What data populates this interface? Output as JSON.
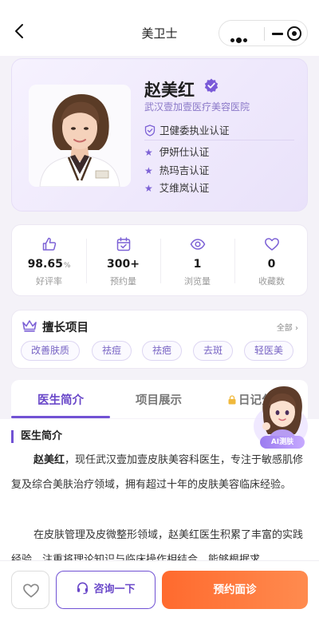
{
  "nav": {
    "title": "美卫士"
  },
  "doctor": {
    "name": "赵美红",
    "hospital": "武汉壹加壹医疗美容医院",
    "certification": "卫健委执业认证",
    "brand_certs": [
      "伊妍仕认证",
      "热玛吉认证",
      "艾维岚认证"
    ]
  },
  "stats": [
    {
      "icon": "thumbs-up-icon",
      "value": "98.65",
      "unit": "%",
      "label": "好评率"
    },
    {
      "icon": "calendar-check-icon",
      "value": "300+",
      "unit": "",
      "label": "预约量"
    },
    {
      "icon": "eye-icon",
      "value": "1",
      "unit": "",
      "label": "浏览量"
    },
    {
      "icon": "heart-icon",
      "value": "0",
      "unit": "",
      "label": "收藏数"
    }
  ],
  "specialties": {
    "title": "擅长项目",
    "view_all": "全部 ›",
    "items": [
      "改善肤质",
      "祛痘",
      "祛疤",
      "去斑",
      "轻医美"
    ]
  },
  "tabs": {
    "items": [
      "医生简介",
      "项目展示",
      "日记分享"
    ],
    "active": 0
  },
  "intro": {
    "heading": "医生简介",
    "p1_name": "赵美红",
    "p1_rest": "，现任武汉壹加壹皮肤美容科医生，专注于敏感肌修复及综合美肤治疗领域，拥有超过十年的皮肤美容临床经验。",
    "p2": "在皮肤管理及皮微整形领域，赵美红医生积累了丰富的实践经验，注重将理论知识与临床操作相结合，能够根据求"
  },
  "ai_assistant": {
    "label": "AI测肤"
  },
  "bottom": {
    "consult_label": "咨询一下",
    "book_label": "预约面诊"
  },
  "colors": {
    "accent": "#7152d4",
    "cta": "#ff6a2e"
  }
}
